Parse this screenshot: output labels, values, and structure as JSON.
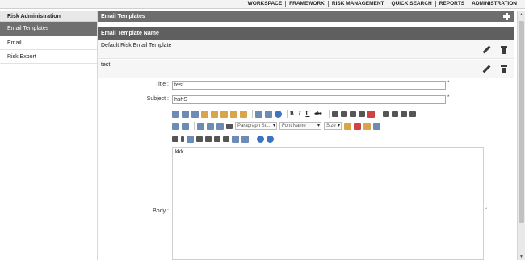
{
  "topnav": {
    "items": [
      "WORKSPACE",
      "FRAMEWORK",
      "RISK MANAGEMENT",
      "QUICK SEARCH",
      "REPORTS",
      "ADMINISTRATION"
    ]
  },
  "sidebar": {
    "title": "Risk Administration",
    "items": [
      {
        "label": "Email Templates",
        "active": true
      },
      {
        "label": "Email",
        "active": false
      },
      {
        "label": "Risk Export",
        "active": false
      }
    ]
  },
  "panel": {
    "title": "Email Templates",
    "column_header": "Email Template Name",
    "rows": [
      {
        "name": "Default Risk Email Template"
      },
      {
        "name": "test"
      }
    ]
  },
  "form": {
    "title_label": "Title :",
    "title_value": "test",
    "subject_label": "Subject :",
    "subject_value": "hshS",
    "body_label": "Body :",
    "body_value": "kkk",
    "required_mark": "*",
    "toolbar": {
      "bold": "B",
      "italic": "I",
      "underline": "U",
      "strike": "abc",
      "paragraph_style": "Paragraph St...",
      "font_name": "Font Name",
      "size": "Size"
    }
  }
}
